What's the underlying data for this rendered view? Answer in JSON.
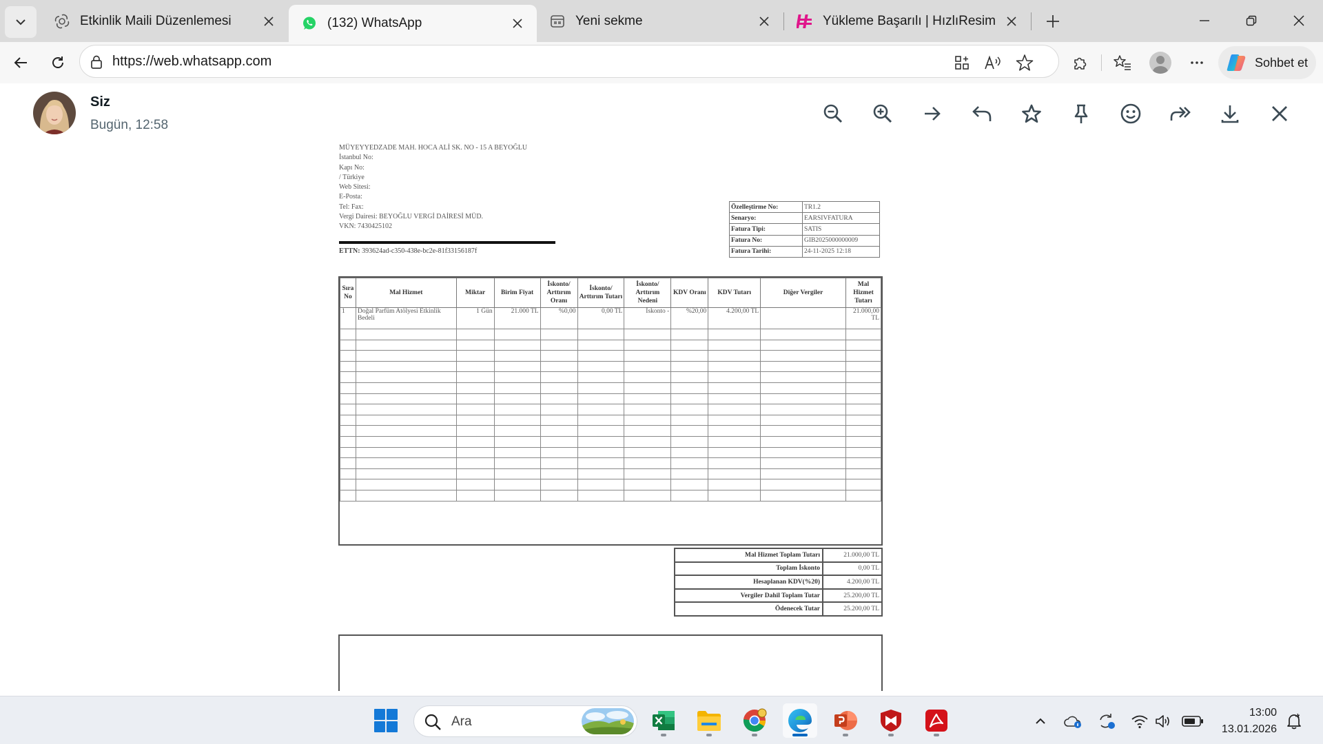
{
  "browser": {
    "tabs": [
      {
        "title": "Etkinlik Maili Düzenlemesi",
        "icon": "openai-icon"
      },
      {
        "title": "(132) WhatsApp",
        "icon": "whatsapp-icon",
        "active": true
      },
      {
        "title": "Yeni sekme",
        "icon": "new-tab-page-icon"
      },
      {
        "title": "Yükleme Başarılı | HızlıResim",
        "icon": "hizliresim-icon"
      }
    ],
    "url": "https://web.whatsapp.com",
    "copilot_label": "Sohbet et"
  },
  "viewer": {
    "sender_name": "Siz",
    "sent_time": "Bugün, 12:58",
    "actions": [
      "zoom-out",
      "zoom-in",
      "forward",
      "reply",
      "star",
      "pin",
      "react",
      "share",
      "download",
      "close"
    ]
  },
  "invoice": {
    "seller_lines": [
      "MÜYEYYEDZADE MAH. HOCA ALİ SK. NO - 15 A BEYOĞLU",
      "İstanbul  No:",
      "Kapı No:",
      " /  Türkiye",
      "Web Sitesi:",
      "E-Posta:",
      "Tel: Fax:",
      "Vergi Dairesi: BEYOĞLU VERGİ DAİRESİ MÜD.",
      "VKN: 7430425102"
    ],
    "ettn_label": "ETTN:",
    "ettn_value": "393624ad-c350-438e-bc2e-81f33156187f",
    "info_rows": [
      {
        "key": "Özelleştirme No:",
        "value": "TR1.2"
      },
      {
        "key": "Senaryo:",
        "value": "EARSIVFATURA"
      },
      {
        "key": "Fatura Tipi:",
        "value": "SATIS"
      },
      {
        "key": "Fatura No:",
        "value": "GIB2025000000009"
      },
      {
        "key": "Fatura Tarihi:",
        "value": "24-11-2025 12:18"
      }
    ],
    "columns": [
      "Sıra No",
      "Mal Hizmet",
      "Miktar",
      "Birim Fiyat",
      "İskonto/ Arttırım Oranı",
      "İskonto/ Arttırım Tutarı",
      "İskonto/ Arttırım Nedeni",
      "KDV Oranı",
      "KDV Tutarı",
      "Diğer Vergiler",
      "Mal Hizmet Tutarı"
    ],
    "items": [
      {
        "no": "1",
        "name": "Doğal Parfüm Atölyesi Etkinlik Bedeli",
        "qty": "1 Gün",
        "unit_price": "21.000 TL",
        "disc_rate": "%0,00",
        "disc_amount": "0,00 TL",
        "disc_reason": "İskonto -",
        "vat_rate": "%20,00",
        "vat_amount": "4.200,00 TL",
        "other_taxes": "",
        "total": "21.000,00 TL"
      }
    ],
    "totals": [
      {
        "label": "Mal Hizmet Toplam Tutarı",
        "value": "21.000,00 TL"
      },
      {
        "label": "Toplam İskonto",
        "value": "0,00 TL"
      },
      {
        "label": "Hesaplanan KDV(%20)",
        "value": "4.200,00 TL"
      },
      {
        "label": "Vergiler Dahil Toplam Tutar",
        "value": "25.200,00 TL"
      },
      {
        "label": "Ödenecek Tutar",
        "value": "25.200,00 TL"
      }
    ]
  },
  "taskbar": {
    "search_placeholder": "Ara",
    "apps": [
      "start-icon",
      "excel-icon",
      "file-explorer-icon",
      "chrome-icon",
      "edge-icon",
      "powerpoint-icon",
      "mcafee-icon",
      "acrobat-icon"
    ],
    "time": "13:00",
    "date": "13.01.2026"
  },
  "colors": {
    "whatsapp_green": "#25d366",
    "edge_blue": "#0067c0",
    "excel_green": "#107c41",
    "powerpoint_red": "#c43e1c",
    "acrobat_red": "#d4121a",
    "mcafee_red": "#c01818"
  }
}
